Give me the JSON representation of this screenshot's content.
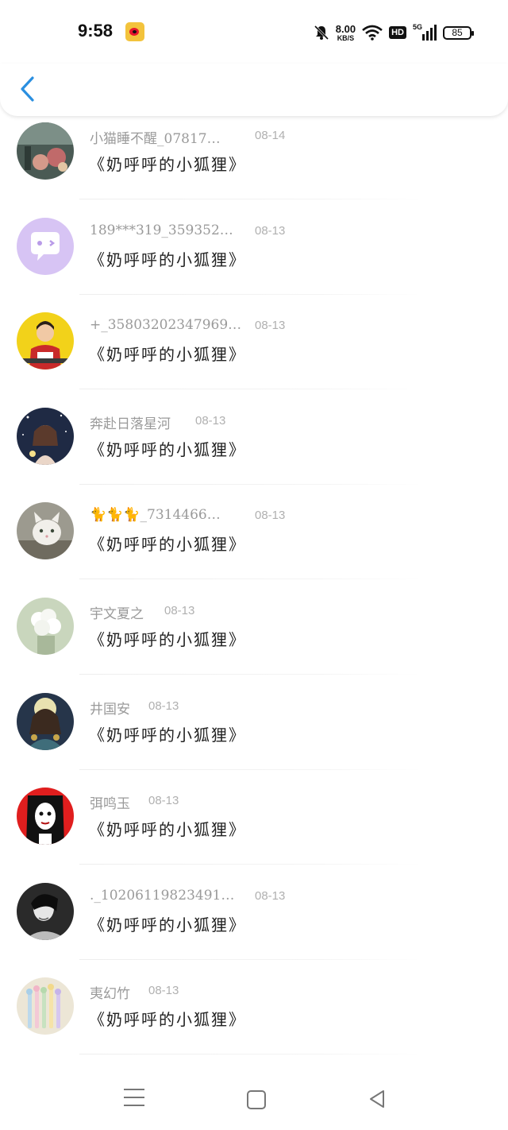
{
  "status_bar": {
    "time": "9:58",
    "app_icon": "weibo-icon",
    "net_speed_value": "8.00",
    "net_speed_unit": "KB/S",
    "hd_label": "HD",
    "network_label": "5G",
    "battery": "85",
    "icons": [
      "bell-muted-icon",
      "wifi-icon",
      "signal-icon",
      "battery-icon"
    ]
  },
  "header": {
    "back_icon": "chevron-left-icon",
    "accent": "#2a8fe0"
  },
  "comments": [
    {
      "name": "小猫睡不醒_07817…",
      "date": "08-14",
      "text": "《奶呼呼的小狐狸》"
    },
    {
      "name": "189***319_359352…",
      "date": "08-13",
      "text": "《奶呼呼的小狐狸》"
    },
    {
      "name": "+_35803202347969…",
      "date": "08-13",
      "text": "《奶呼呼的小狐狸》"
    },
    {
      "name": "奔赴日落星河",
      "date": "08-13",
      "text": "《奶呼呼的小狐狸》"
    },
    {
      "name": "🐈🐈🐈_7314466…",
      "date": "08-13",
      "text": "《奶呼呼的小狐狸》"
    },
    {
      "name": "宇文夏之",
      "date": "08-13",
      "text": "《奶呼呼的小狐狸》"
    },
    {
      "name": "井国安",
      "date": "08-13",
      "text": "《奶呼呼的小狐狸》"
    },
    {
      "name": "弭鸣玉",
      "date": "08-13",
      "text": "《奶呼呼的小狐狸》"
    },
    {
      "name": "._10206119823491…",
      "date": "08-13",
      "text": "《奶呼呼的小狐狸》"
    },
    {
      "name": "夷幻竹",
      "date": "08-13",
      "text": "《奶呼呼的小狐狸》"
    }
  ],
  "nav_bar": {
    "icons": [
      "menu-icon",
      "home-icon",
      "back-triangle-icon"
    ]
  }
}
